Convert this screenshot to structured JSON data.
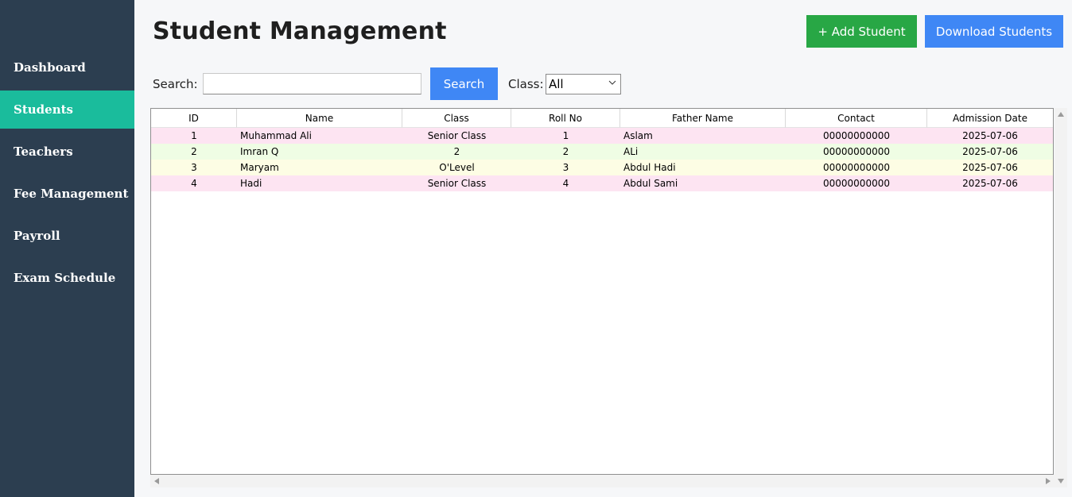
{
  "sidebar": {
    "items": [
      {
        "label": "Dashboard",
        "active": false
      },
      {
        "label": "Students",
        "active": true
      },
      {
        "label": "Teachers",
        "active": false
      },
      {
        "label": "Fee Management",
        "active": false
      },
      {
        "label": "Payroll",
        "active": false
      },
      {
        "label": "Exam Schedule",
        "active": false
      }
    ]
  },
  "header": {
    "title": "Student Management",
    "add_label": "+ Add Student",
    "download_label": "Download Students"
  },
  "search": {
    "label": "Search:",
    "value": "",
    "placeholder": "",
    "button_label": "Search",
    "class_label": "Class:",
    "class_selected": "All"
  },
  "table": {
    "columns": [
      "ID",
      "Name",
      "Class",
      "Roll No",
      "Father Name",
      "Contact",
      "Admission Date"
    ],
    "rows": [
      {
        "id": "1",
        "name": "Muhammad Ali",
        "class": "Senior Class",
        "roll": "1",
        "father": "Aslam",
        "contact": "00000000000",
        "date": "2025-07-06",
        "color": "#fde4f2"
      },
      {
        "id": "2",
        "name": "Imran Q",
        "class": "2",
        "roll": "2",
        "father": "ALi",
        "contact": "00000000000",
        "date": "2025-07-06",
        "color": "#effde4"
      },
      {
        "id": "3",
        "name": "Maryam",
        "class": "O'Level",
        "roll": "3",
        "father": "Abdul Hadi",
        "contact": "00000000000",
        "date": "2025-07-06",
        "color": "#fdfde4"
      },
      {
        "id": "4",
        "name": "Hadi",
        "class": "Senior Class",
        "roll": "4",
        "father": "Abdul Sami",
        "contact": "00000000000",
        "date": "2025-07-06",
        "color": "#fde4f2"
      }
    ]
  },
  "colors": {
    "sidebar_bg": "#2c3e50",
    "sidebar_active": "#1abc9c",
    "add_button": "#28a745",
    "primary_button": "#3f87f5"
  }
}
